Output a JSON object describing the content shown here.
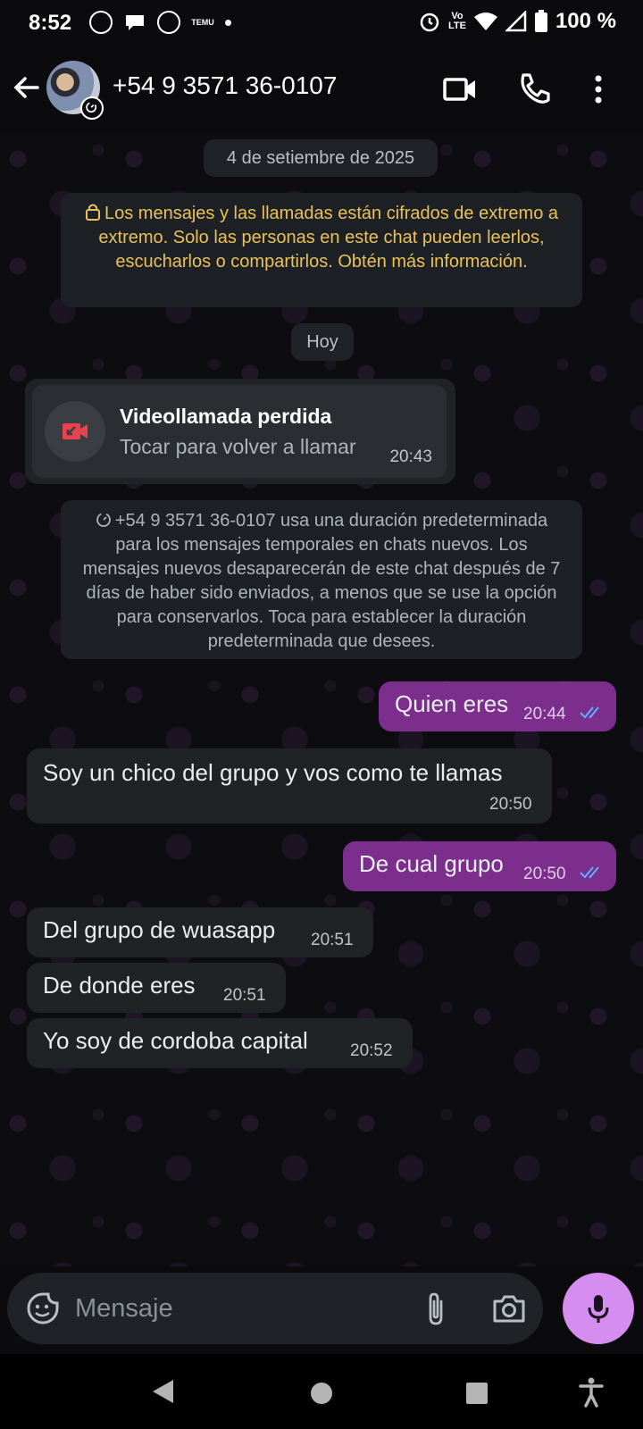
{
  "status_bar": {
    "time": "8:52",
    "battery": "100 %",
    "network_top": "Vo",
    "network_bottom": "LTE",
    "notif_temu": "TEMU"
  },
  "header": {
    "contact": "+54 9 3571 36-0107"
  },
  "chat": {
    "date_pill": "4 de setiembre de 2025",
    "encryption_notice": "Los mensajes y las llamadas están cifrados de extremo a extremo. Solo las personas en este chat pueden leerlos, escucharlos o compartirlos. Obtén más información.",
    "today_pill": "Hoy",
    "missed_call": {
      "title": "Videollamada perdida",
      "subtitle": "Tocar para volver a llamar",
      "time": "20:43"
    },
    "disappearing_notice": "+54 9 3571 36-0107 usa una duración predeterminada para los mensajes temporales en chats nuevos. Los mensajes nuevos desaparecerán de este chat después de 7 días de haber sido enviados, a menos que se use la opción para conservarlos. Toca para establecer la duración predeterminada que desees.",
    "messages": [
      {
        "dir": "out",
        "text": "Quien eres",
        "time": "20:44"
      },
      {
        "dir": "in",
        "text": "Soy un chico del grupo y vos como te llamas",
        "time": "20:50"
      },
      {
        "dir": "out",
        "text": "De cual grupo",
        "time": "20:50"
      },
      {
        "dir": "in",
        "text": "Del grupo de wuasapp",
        "time": "20:51"
      },
      {
        "dir": "in",
        "text": "De donde eres",
        "time": "20:51"
      },
      {
        "dir": "in",
        "text": "Yo soy de cordoba capital",
        "time": "20:52"
      }
    ]
  },
  "composer": {
    "placeholder": "Mensaje"
  },
  "colors": {
    "outgoing_bubble": "#7b2e8c",
    "incoming_bubble": "#202326",
    "mic_button": "#d68df0",
    "read_ticks": "#5fb0ff",
    "notice_yellow": "#e8c259"
  },
  "icons": [
    "back-arrow-icon",
    "video-call-icon",
    "phone-icon",
    "more-vert-icon",
    "lock-icon",
    "missed-video-icon",
    "timer-icon",
    "sticker-icon",
    "attach-icon",
    "camera-icon",
    "mic-icon",
    "double-check-icon",
    "nav-back-icon",
    "nav-home-icon",
    "nav-recents-icon",
    "accessibility-icon"
  ]
}
